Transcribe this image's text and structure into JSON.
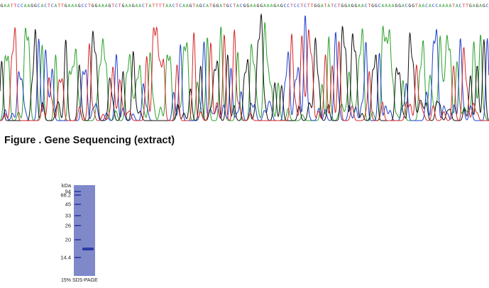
{
  "sequence": "GAATTCCAAGGCACTCATTGAAAGCCTGGAAAGTCTGAAGAACTATTTTAACTCAAGTAGCATGGATGCTACGGAAGGAAAGAGCCTCCTCTTGGATATCTGGAGGAACTGGCAAAAGGACGGTAACACCAAAATACTTGAGAGC",
  "base_colors": {
    "A": "#2ca02c",
    "C": "#1f3fcf",
    "G": "#111111",
    "T": "#d62728"
  },
  "figure_caption": "Figure . Gene Sequencing (extract)",
  "gel": {
    "unit_label": "kDa",
    "markers": [
      "94",
      "66.2",
      "45",
      "33",
      "26",
      "20",
      "14.4"
    ],
    "caption": "15% SDS-PAGE",
    "lane_color": "#7f89c9",
    "band_color": "#2b3aa6"
  }
}
